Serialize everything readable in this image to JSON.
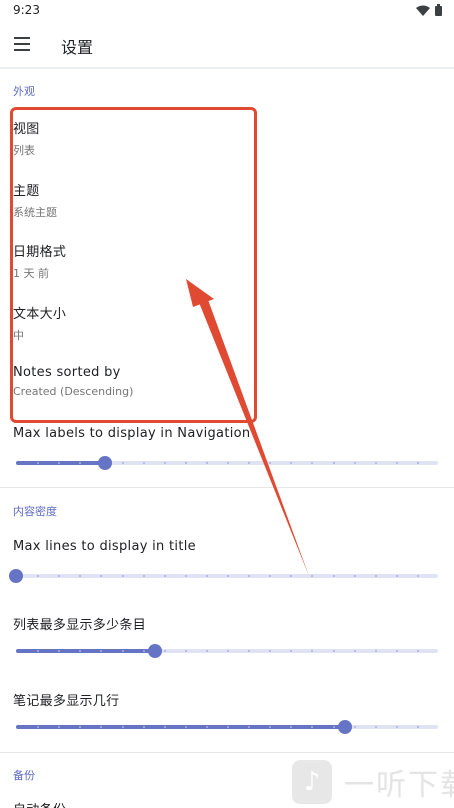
{
  "status_bar": {
    "time": "9:23"
  },
  "app_bar": {
    "title": "设置"
  },
  "appearance": {
    "header": "外观",
    "items": [
      {
        "title": "视图",
        "summary": "列表"
      },
      {
        "title": "主题",
        "summary": "系统主题"
      },
      {
        "title": "日期格式",
        "summary": "1 天 前"
      },
      {
        "title": "文本大小",
        "summary": "中"
      },
      {
        "title": "Notes sorted by",
        "summary": "Created (Descending)"
      }
    ],
    "nav_labels_slider": {
      "label": "Max labels to display in Navigation",
      "value_fraction": 0.21
    }
  },
  "content_density": {
    "header": "内容密度",
    "sliders": [
      {
        "label": "Max lines to display in title",
        "value_fraction": 0.0
      },
      {
        "label": "列表最多显示多少条目",
        "value_fraction": 0.33
      },
      {
        "label": "笔记最多显示几行",
        "value_fraction": 0.78
      }
    ]
  },
  "backup": {
    "header": "备份",
    "first_item_title": "自动备份"
  },
  "watermark": {
    "text": "一听下载"
  },
  "colors": {
    "accent": "#6674c6",
    "section_header": "#5c6bc0",
    "annotation": "#e04a33"
  },
  "icons": {
    "menu": "menu-icon",
    "wifi": "wifi-icon",
    "battery": "battery-icon"
  }
}
